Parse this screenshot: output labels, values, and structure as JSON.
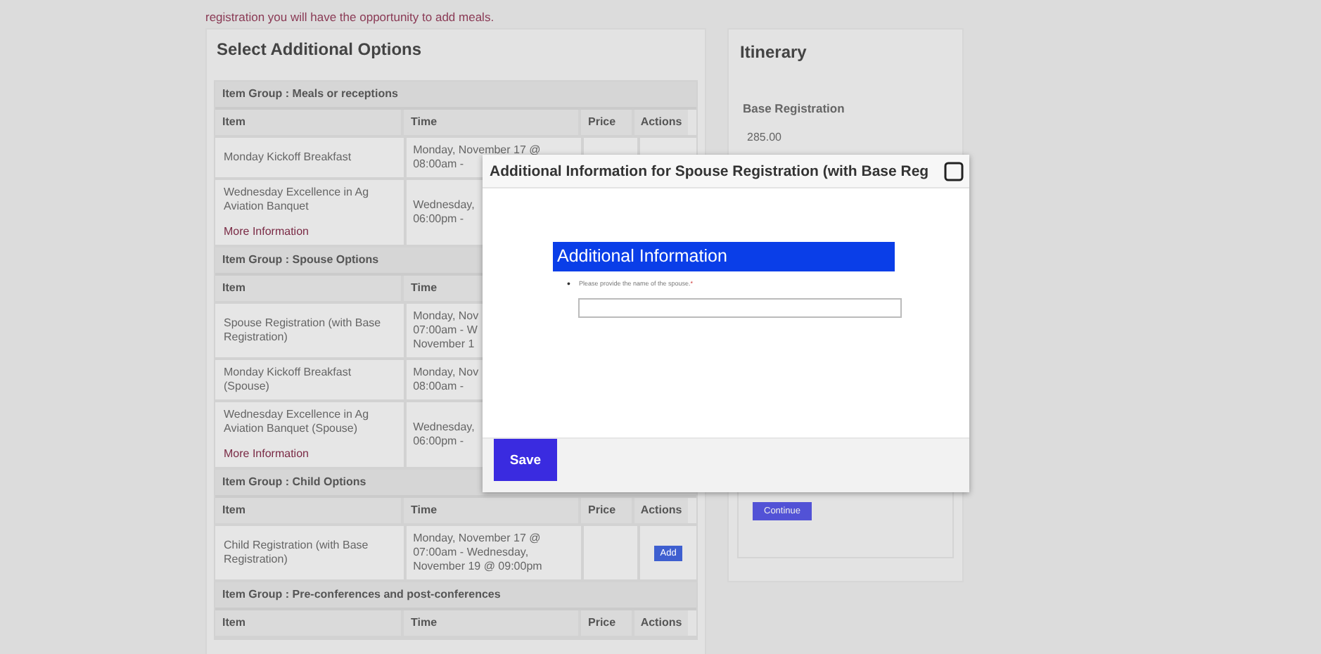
{
  "intro": "registration you will have the opportunity to add meals.",
  "options": {
    "title": "Select Additional Options",
    "groups": [
      {
        "title": "Item Group : Meals or receptions",
        "columns": [
          "Item",
          "Time",
          "Price",
          "Actions"
        ],
        "rows": [
          {
            "item": "Monday Kickoff Breakfast",
            "time": "Monday, November 17 @\n08:00am -"
          },
          {
            "item": "Wednesday Excellence in Ag Aviation Banquet",
            "link": "More Information",
            "time": "Wednesday,\n06:00pm -"
          }
        ]
      },
      {
        "title": "Item Group : Spouse Options",
        "columns": [
          "Item",
          "Time"
        ],
        "rows": [
          {
            "item": "Spouse Registration (with Base Registration)",
            "time": "Monday, Nov\n07:00am - W\nNovember 1"
          },
          {
            "item": "Monday Kickoff Breakfast (Spouse)",
            "time": "Monday, Nov\n08:00am -"
          },
          {
            "item": "Wednesday Excellence in Ag Aviation Banquet (Spouse)",
            "link": "More Information",
            "time": "Wednesday,\n06:00pm -"
          }
        ]
      },
      {
        "title": "Item Group : Child Options",
        "columns": [
          "Item",
          "Time",
          "Price",
          "Actions"
        ],
        "rows": [
          {
            "item": "Child Registration (with Base Registration)",
            "time": "Monday, November 17 @\n07:00am - Wednesday,\nNovember 19 @ 09:00pm",
            "action": "Add"
          }
        ]
      },
      {
        "title": "Item Group : Pre-conferences and post-conferences",
        "columns": [
          "Item",
          "Time",
          "Price",
          "Actions"
        ]
      }
    ]
  },
  "itinerary": {
    "title": "Itinerary",
    "items": [
      {
        "name": "Base Registration",
        "price": "285.00"
      }
    ],
    "button": "Continue"
  },
  "modal": {
    "title": "Additional Information for Spouse Registration (with Base Reg",
    "section": "Additional Information",
    "fields": [
      {
        "marker": "•",
        "label": "Please provide the name of the spouse.",
        "required_mark": "*"
      }
    ],
    "save": "Save"
  }
}
